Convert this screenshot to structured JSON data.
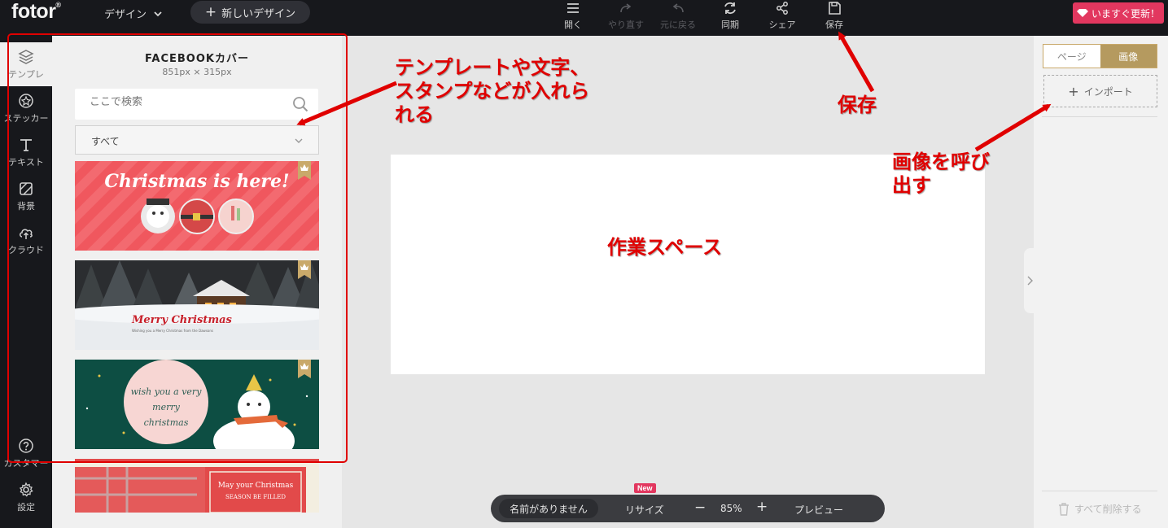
{
  "topbar": {
    "logo": "fotor",
    "logo_mark": "®",
    "design_menu": "デザイン",
    "new_design": "新しいデザイン",
    "tools": {
      "open": "開く",
      "redo": "やり直す",
      "undo": "元に戻る",
      "sync": "同期",
      "share": "シェア",
      "save": "保存"
    },
    "upgrade": "いますぐ更新！"
  },
  "rail": {
    "template": "テンプレ",
    "sticker": "ステッカー",
    "text": "テキスト",
    "background": "背景",
    "cloud": "クラウド",
    "support": "カスタマー",
    "settings": "設定"
  },
  "panel": {
    "title": "FACEBOOKカバー",
    "size": "851px × 315px",
    "search_placeholder": "ここで検索",
    "filter": "すべて",
    "templates": [
      {
        "text": "Christmas is here!"
      },
      {
        "text": "Merry Christmas",
        "subtext": "Wishing you a Merry Christmas from the Dawsons"
      },
      {
        "text_line1": "wish you a very",
        "text_line2": "merry christmas"
      },
      {
        "text_line1": "May your Christmas",
        "text_line2": "SEASON BE FILLED"
      }
    ]
  },
  "bottom_bar": {
    "name": "名前がありません",
    "resize": "リサイズ",
    "new_badge": "New",
    "zoom_out": "−",
    "zoom": "85%",
    "zoom_in": "+",
    "preview": "プレビュー"
  },
  "right_panel": {
    "tab_page": "ページ",
    "tab_image": "画像",
    "import": "インポート",
    "delete_all": "すべて削除する"
  },
  "annotations": {
    "panel_note_1": "テンプレートや文字、",
    "panel_note_2": "スタンプなどが入れら",
    "panel_note_3": "れる",
    "save_note": "保存",
    "import_note_1": "画像を呼び",
    "import_note_2": "出す",
    "workspace_note": "作業スペース"
  },
  "colors": {
    "annotation": "#e00000",
    "accent_gold": "#b59a5f",
    "upgrade": "#e2375f",
    "dark": "#17181c"
  }
}
